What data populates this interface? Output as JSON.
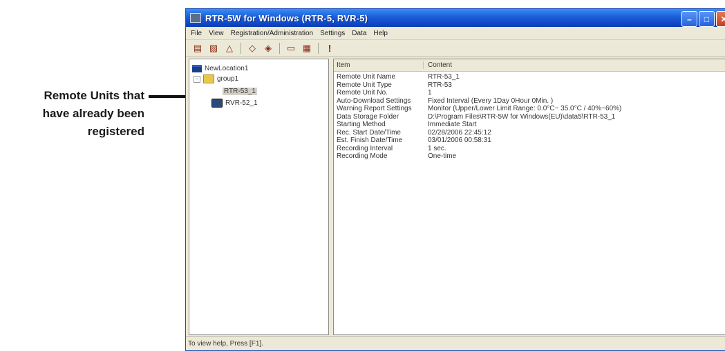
{
  "callout": {
    "line1": "Remote Units that",
    "line2": "have already been",
    "line3": "registered"
  },
  "window": {
    "title": "RTR-5W for Windows (RTR-5, RVR-5)",
    "min_icon": "minimize-icon",
    "max_icon": "maximize-icon",
    "close_icon": "close-icon"
  },
  "menu": [
    "File",
    "View",
    "Registration/Administration",
    "Settings",
    "Data",
    "Help"
  ],
  "tree": {
    "root": "NewLocation1",
    "group": "group1",
    "units": [
      "RTR-53_1",
      "RVR-52_1"
    ]
  },
  "detail": {
    "headers": {
      "item": "Item",
      "content": "Content"
    },
    "rows": [
      {
        "item": "Remote Unit Name",
        "content": "RTR-53_1"
      },
      {
        "item": "Remote Unit Type",
        "content": "RTR-53"
      },
      {
        "item": "Remote Unit No.",
        "content": "1"
      },
      {
        "item": "Auto-Download Settings",
        "content": "Fixed Interval (Every 1Day 0Hour 0Min. )"
      },
      {
        "item": "Warning Report Settings",
        "content": "Monitor (Upper/Lower Limit Range: 0.0°C~ 35.0°C / 40%~60%)"
      },
      {
        "item": "Data Storage Folder",
        "content": "D:\\Program Files\\RTR-5W for Windows(EU)\\data5\\RTR-53_1"
      },
      {
        "item": "Starting Method",
        "content": "Immediate Start"
      },
      {
        "item": "Rec. Start Date/Time",
        "content": "02/28/2006 22:45:12"
      },
      {
        "item": "Est. Finish Date/Time",
        "content": "03/01/2006 00:58:31"
      },
      {
        "item": "Recording Interval",
        "content": "1 sec."
      },
      {
        "item": "Recording Mode",
        "content": "One-time"
      }
    ]
  },
  "status": "To view help, Press [F1]."
}
